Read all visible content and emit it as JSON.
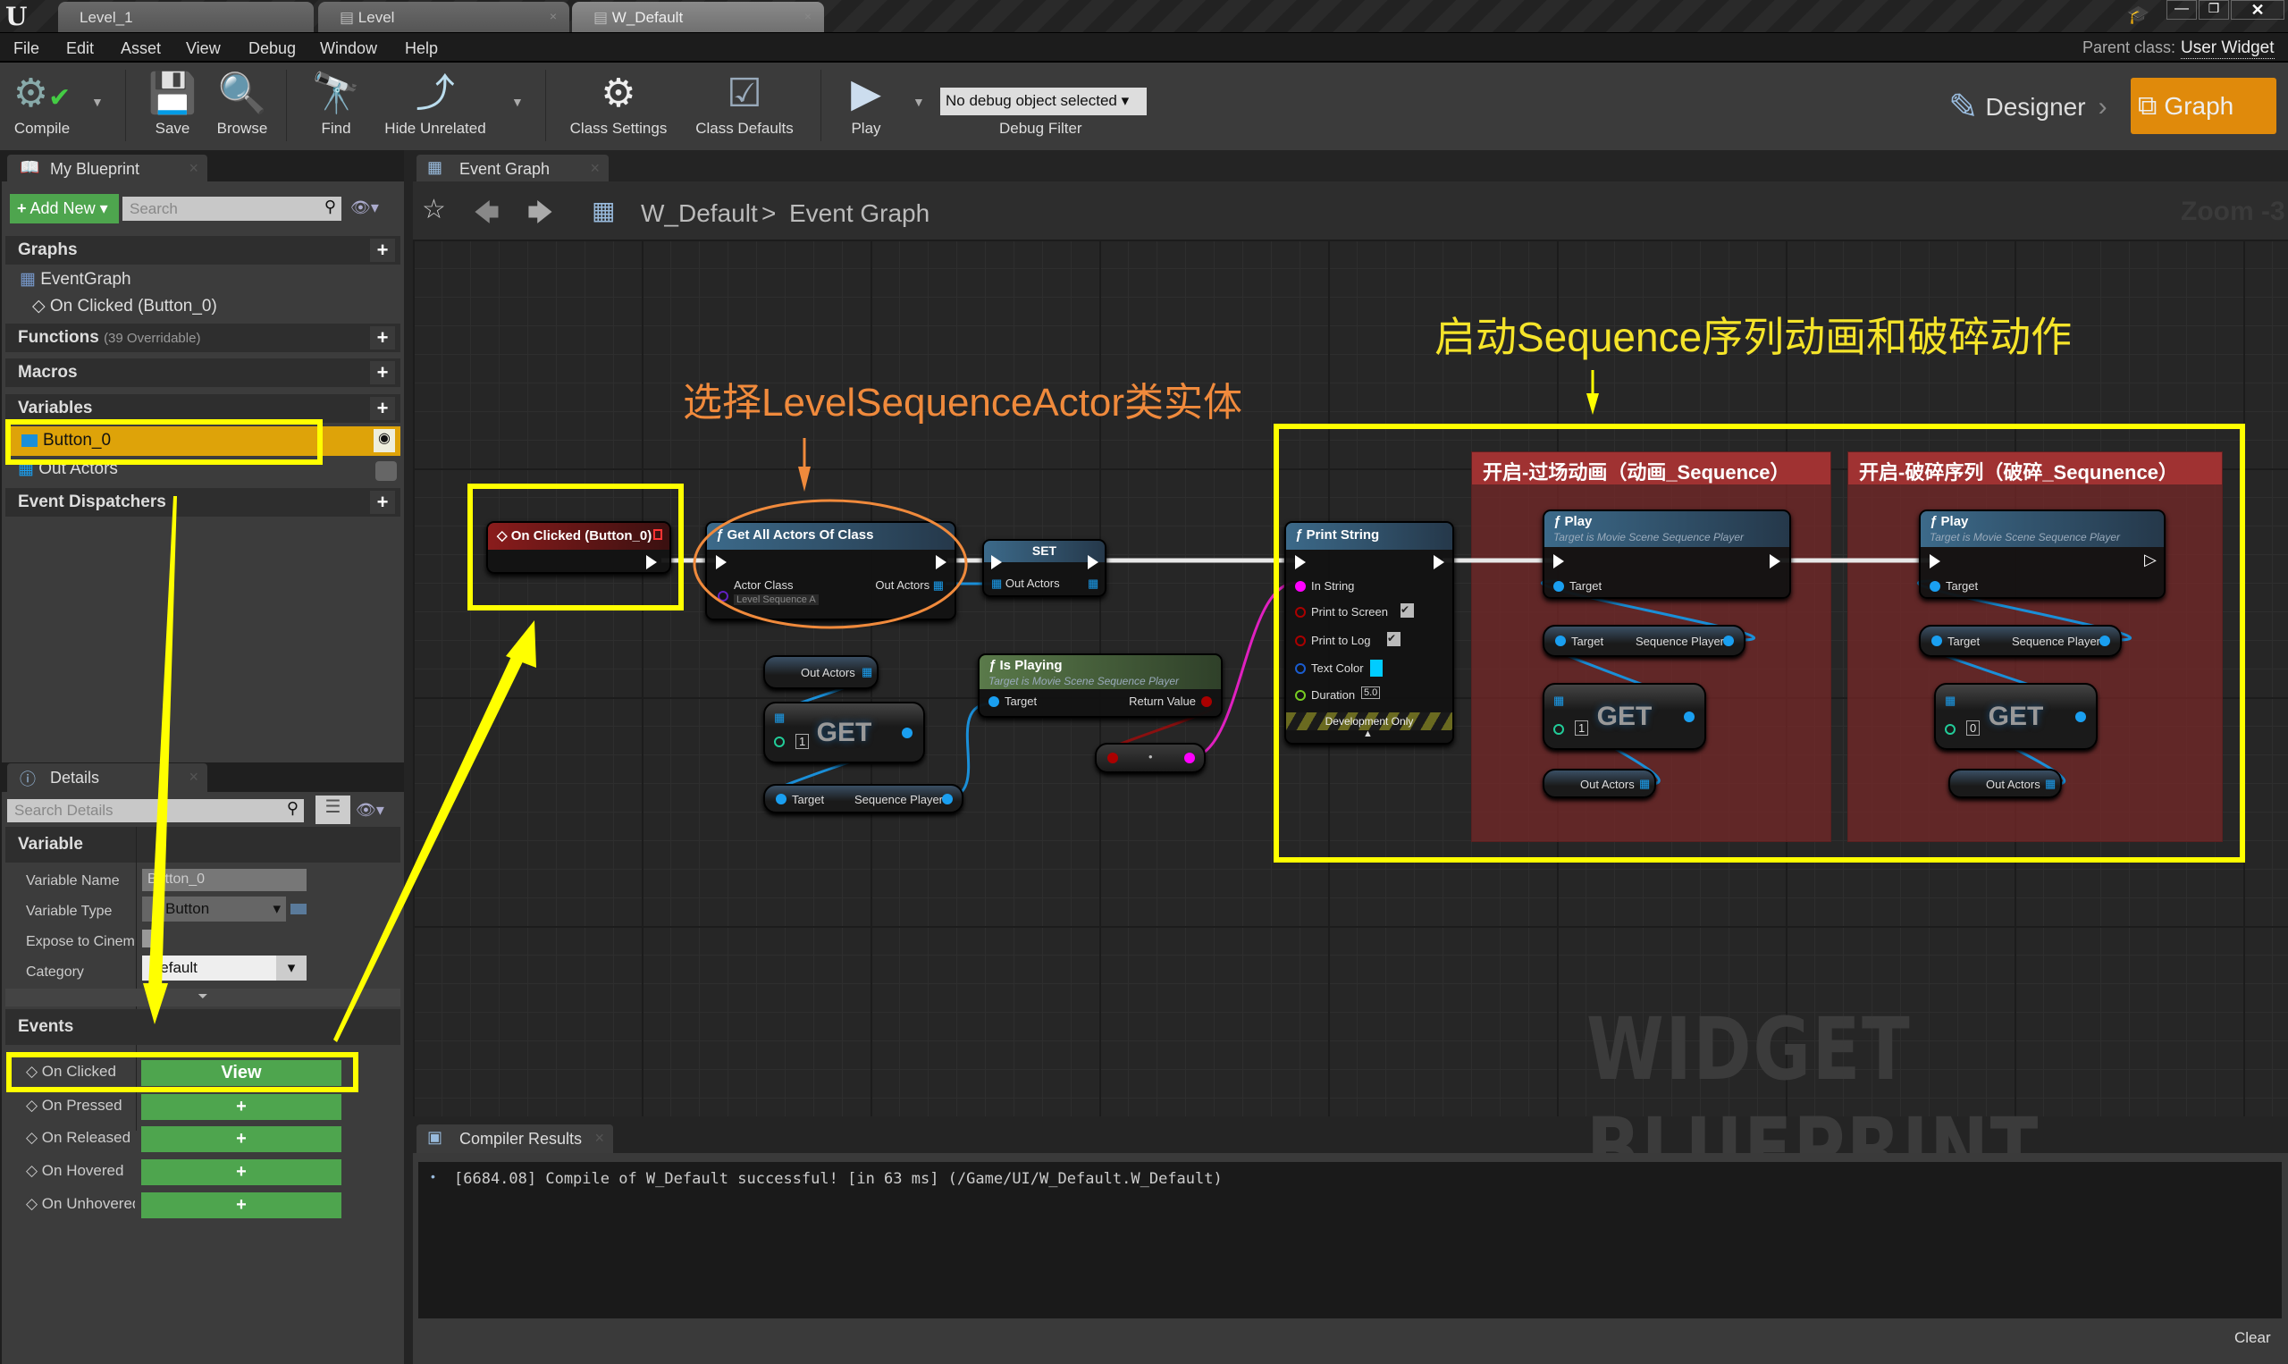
{
  "window": {
    "tabs": [
      {
        "label": "Level_1"
      },
      {
        "label": "Level"
      },
      {
        "label": "W_Default"
      }
    ],
    "parent_class_label": "Parent class:",
    "parent_class_value": "User Widget"
  },
  "menu": [
    "File",
    "Edit",
    "Asset",
    "View",
    "Debug",
    "Window",
    "Help"
  ],
  "toolbar": {
    "compile": "Compile",
    "save": "Save",
    "browse": "Browse",
    "find": "Find",
    "hide_unrelated": "Hide Unrelated",
    "class_settings": "Class Settings",
    "class_defaults": "Class Defaults",
    "play": "Play",
    "debug_select": "No debug object selected",
    "debug_filter": "Debug Filter",
    "designer": "Designer",
    "graph": "Graph",
    "graph_active_color": "#e08a0b"
  },
  "my_blueprint": {
    "tab": "My Blueprint",
    "add_new": "Add New",
    "search_placeholder": "Search",
    "graphs": "Graphs",
    "event_graph": "EventGraph",
    "on_clicked": "On Clicked (Button_0)",
    "functions": "Functions",
    "functions_note": "(39 Overridable)",
    "macros": "Macros",
    "variables": "Variables",
    "var_selected": "Button_0",
    "var_other": "Out Actors",
    "event_dispatchers": "Event Dispatchers"
  },
  "details": {
    "tab": "Details",
    "search_placeholder": "Search Details",
    "variable_section": "Variable",
    "rows": [
      {
        "label": "Variable Name",
        "value": "Button_0"
      },
      {
        "label": "Variable Type",
        "value": "Button"
      },
      {
        "label": "Expose to Cinem",
        "value": ""
      },
      {
        "label": "Category",
        "value": "Default"
      }
    ],
    "events_section": "Events",
    "events": [
      {
        "label": "On Clicked",
        "action": "View"
      },
      {
        "label": "On Pressed",
        "action": "+"
      },
      {
        "label": "On Released",
        "action": "+"
      },
      {
        "label": "On Hovered",
        "action": "+"
      },
      {
        "label": "On Unhovered",
        "action": "+"
      }
    ]
  },
  "graph": {
    "tab": "Event Graph",
    "breadcrumb_root": "W_Default",
    "breadcrumb_sep": ">",
    "breadcrumb_leaf": "Event Graph",
    "zoom": "Zoom -3",
    "watermark": "WIDGET BLUEPRINT",
    "annotation_left": "选择LevelSequenceActor类实体",
    "annotation_right": "启动Sequence序列动画和破碎动作",
    "nodes": {
      "on_clicked": "On Clicked (Button_0)",
      "get_all": {
        "title": "Get All Actors Of Class",
        "actor_class": "Actor Class",
        "actor_class_value": "Level Sequence A",
        "out_actors": "Out Actors"
      },
      "set": {
        "title": "SET",
        "out_actors": "Out Actors"
      },
      "print": {
        "title": "Print String",
        "in_string": "In String",
        "print_screen": "Print to Screen",
        "print_log": "Print to Log",
        "text_color": "Text Color",
        "duration": "Duration",
        "duration_value": "5.0",
        "dev_only": "Development Only"
      },
      "out_actors_getter": "Out Actors",
      "get": "GET",
      "get_index_1": "1",
      "get_index_0": "0",
      "seq_player": {
        "target": "Target",
        "seq": "Sequence Player"
      },
      "is_playing": {
        "title": "Is Playing",
        "sub": "Target is Movie Scene Sequence Player",
        "target": "Target",
        "ret": "Return Value"
      },
      "play": {
        "title": "Play",
        "sub": "Target is Movie Scene Sequence Player",
        "target": "Target"
      }
    },
    "comments": [
      "开启-过场动画（动画_Sequence）",
      "开启-破碎序列（破碎_Sequnence）"
    ]
  },
  "compiler": {
    "tab": "Compiler Results",
    "message": "[6684.08] Compile of W_Default successful! [in 63 ms] (/Game/UI/W_Default.W_Default)",
    "clear": "Clear"
  }
}
